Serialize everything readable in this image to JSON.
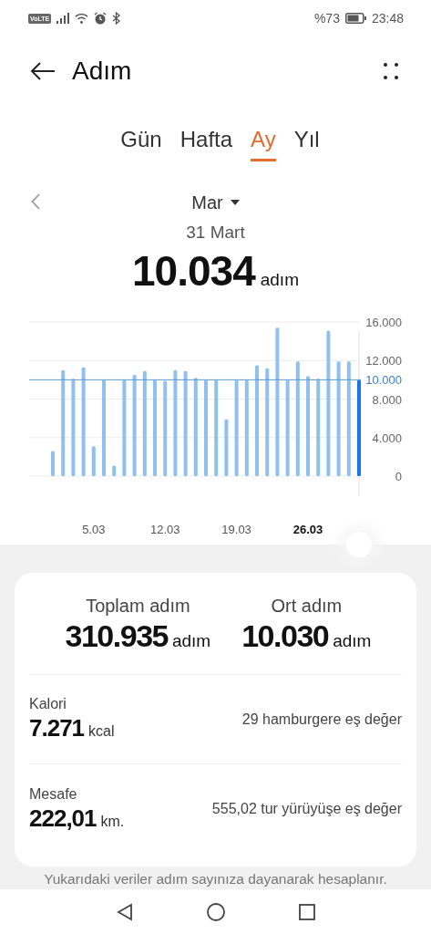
{
  "status_bar": {
    "network_badge": "VoLTE",
    "battery_percent": "%73",
    "time": "23:48"
  },
  "header": {
    "title": "Adım"
  },
  "tabs": [
    {
      "label": "Gün",
      "selected": false
    },
    {
      "label": "Hafta",
      "selected": false
    },
    {
      "label": "Ay",
      "selected": true
    },
    {
      "label": "Yıl",
      "selected": false
    }
  ],
  "month_picker": {
    "label": "Mar"
  },
  "selected_day": {
    "date": "31 Mart",
    "value": "10.034",
    "unit": "adım"
  },
  "chart": {
    "bars": [
      {
        "selected": false
      },
      {
        "selected": false
      },
      {
        "selected": false
      },
      {
        "selected": false
      },
      {
        "selected": false
      },
      {
        "selected": false
      },
      {
        "selected": false
      },
      {
        "selected": false
      },
      {
        "selected": false
      },
      {
        "selected": false
      },
      {
        "selected": false
      },
      {
        "selected": false
      },
      {
        "selected": false
      },
      {
        "selected": false
      },
      {
        "selected": false
      },
      {
        "selected": false
      },
      {
        "selected": false
      },
      {
        "selected": false
      },
      {
        "selected": false
      },
      {
        "selected": false
      },
      {
        "selected": false
      },
      {
        "selected": false
      },
      {
        "selected": false
      },
      {
        "selected": false
      },
      {
        "selected": false
      },
      {
        "selected": false
      },
      {
        "selected": false
      },
      {
        "selected": false
      },
      {
        "selected": false
      },
      {
        "selected": false
      },
      {
        "selected": true
      }
    ],
    "chart_data": {
      "type": "bar",
      "categories": [
        null,
        null,
        null,
        null,
        "5.03",
        null,
        null,
        null,
        null,
        null,
        null,
        "12.03",
        null,
        null,
        null,
        null,
        null,
        null,
        "19.03",
        null,
        null,
        null,
        null,
        null,
        null,
        "26.03",
        null,
        null,
        null,
        null,
        null
      ],
      "values": [
        2.6,
        11.0,
        10.1,
        11.3,
        3.1,
        10.0,
        1.1,
        10.0,
        10.5,
        10.9,
        10.0,
        9.9,
        11.0,
        10.9,
        10.2,
        10.0,
        10.0,
        5.9,
        10.0,
        10.0,
        11.5,
        11.2,
        15.4,
        10.0,
        11.9,
        10.4,
        10.1,
        15.1,
        11.9,
        11.9,
        10.0
      ],
      "ylim": [
        0,
        16
      ],
      "yticks": [
        {
          "value": 0,
          "label": "0"
        },
        {
          "value": 4,
          "label": "4.000"
        },
        {
          "value": 8,
          "label": "8.000"
        },
        {
          "value": 12,
          "label": "12.000"
        },
        {
          "value": 16,
          "label": "16.000"
        }
      ],
      "grid": true,
      "ref_lines": [
        {
          "axis": "y",
          "value": 10,
          "label": "10.000"
        }
      ]
    }
  },
  "summary": {
    "stats": [
      {
        "label": "Toplam adım",
        "value": "310.935",
        "unit": "adım"
      },
      {
        "label": "Ort adım",
        "value": "10.030",
        "unit": "adım"
      }
    ],
    "rows": [
      {
        "label": "Kalori",
        "value": "7.271",
        "unit": "kcal",
        "equivalent": "29 hamburgere eş değer"
      },
      {
        "label": "Mesafe",
        "value": "222,01",
        "unit": "km.",
        "equivalent": "555,02 tur yürüyüşe eş değer"
      }
    ]
  },
  "footer_note": "Yukarıdaki veriler adım sayınıza dayanarak hesaplanır."
}
